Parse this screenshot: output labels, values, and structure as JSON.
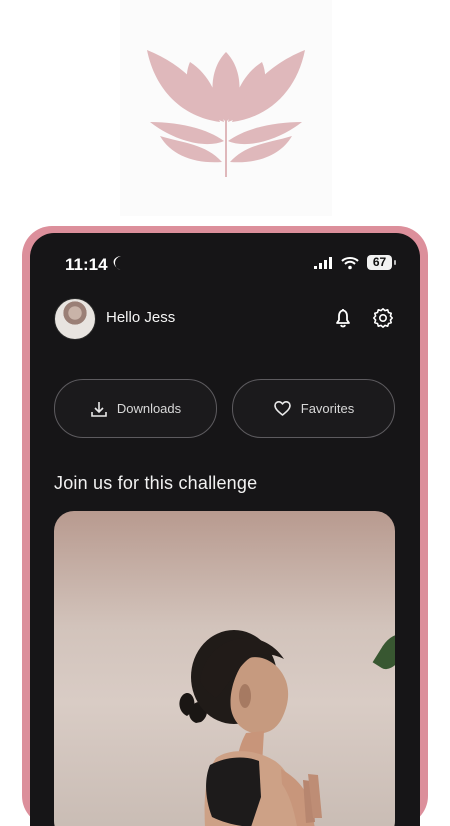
{
  "status_bar": {
    "time": "11:14",
    "battery": "67",
    "icons": [
      "moon-icon",
      "cellular-signal-icon",
      "wifi-icon",
      "battery-icon"
    ]
  },
  "header": {
    "greeting": "Hello Jess",
    "icons": [
      "bell-icon",
      "gear-icon"
    ]
  },
  "quick_actions": [
    {
      "label": "Downloads",
      "icon": "download-icon"
    },
    {
      "label": "Favorites",
      "icon": "heart-icon"
    }
  ],
  "section": {
    "title": "Join us for this challenge"
  },
  "colors": {
    "brand_pink": "#dc8f9b",
    "logo_pink": "#dfb8bb",
    "screen_bg": "#161517",
    "pill_border": "#5d5b5f"
  }
}
